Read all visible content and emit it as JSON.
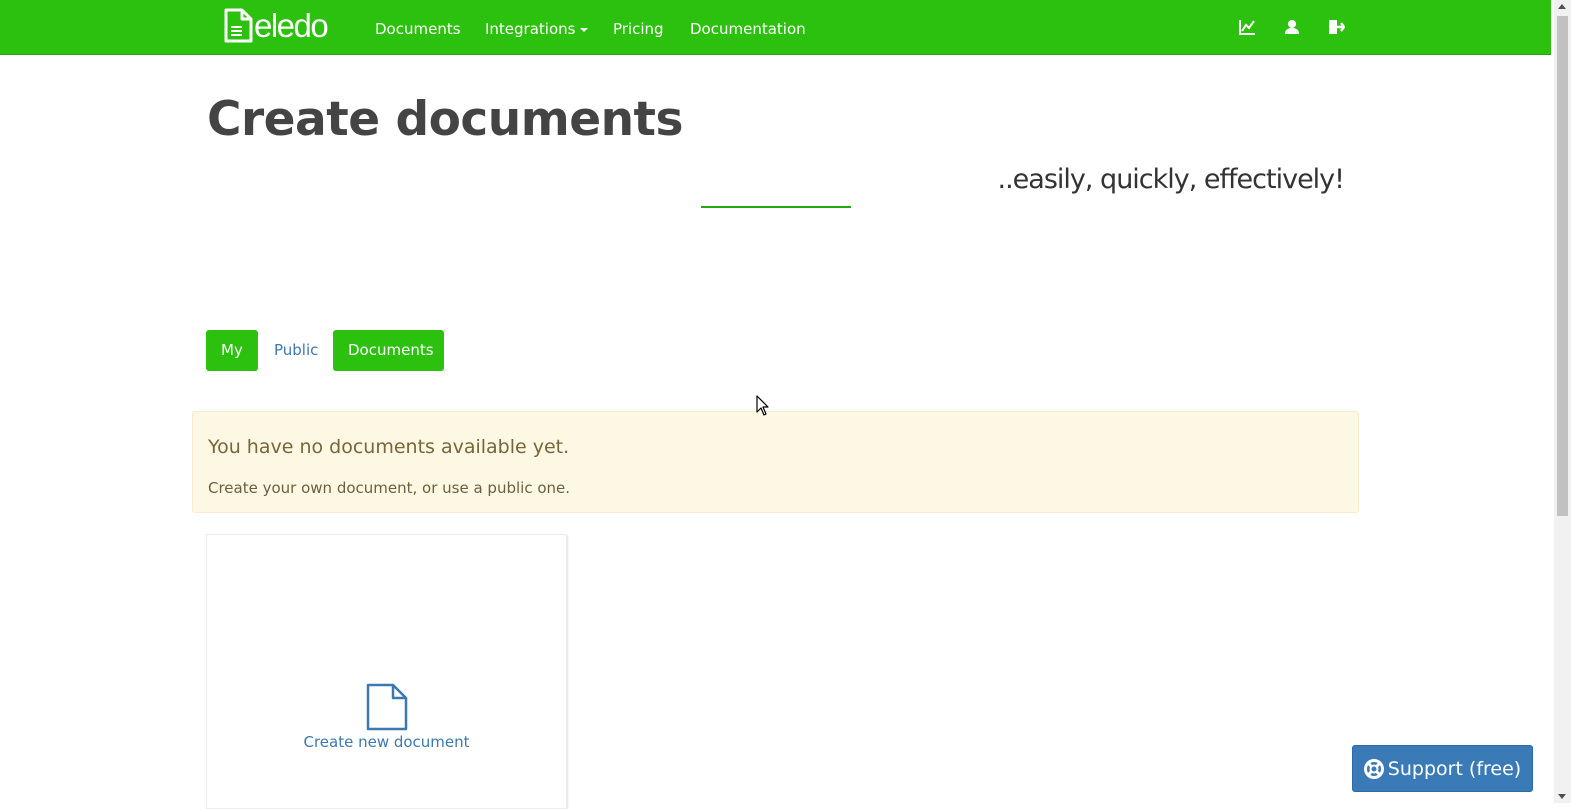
{
  "navbar": {
    "brand": "eledo",
    "links": {
      "documents": "Documents",
      "integrations": "Integrations",
      "pricing": "Pricing",
      "documentation": "Documentation"
    },
    "icons": [
      "chart-icon",
      "user-icon",
      "logout-icon"
    ],
    "background_color": "#2cc10f"
  },
  "header": {
    "title": "Create documents",
    "tagline": "..easily, quickly, effectively!"
  },
  "filters": {
    "my": "My",
    "public": "Public",
    "documents": "Documents"
  },
  "alert": {
    "title": "You have no documents available yet.",
    "text": "Create your own document, or use a public one."
  },
  "new_document_card": {
    "label": "Create new document",
    "icon": "file-icon"
  },
  "support": {
    "label": "Support (free)",
    "icon": "life-ring-icon",
    "color": "#3a7ab7"
  }
}
